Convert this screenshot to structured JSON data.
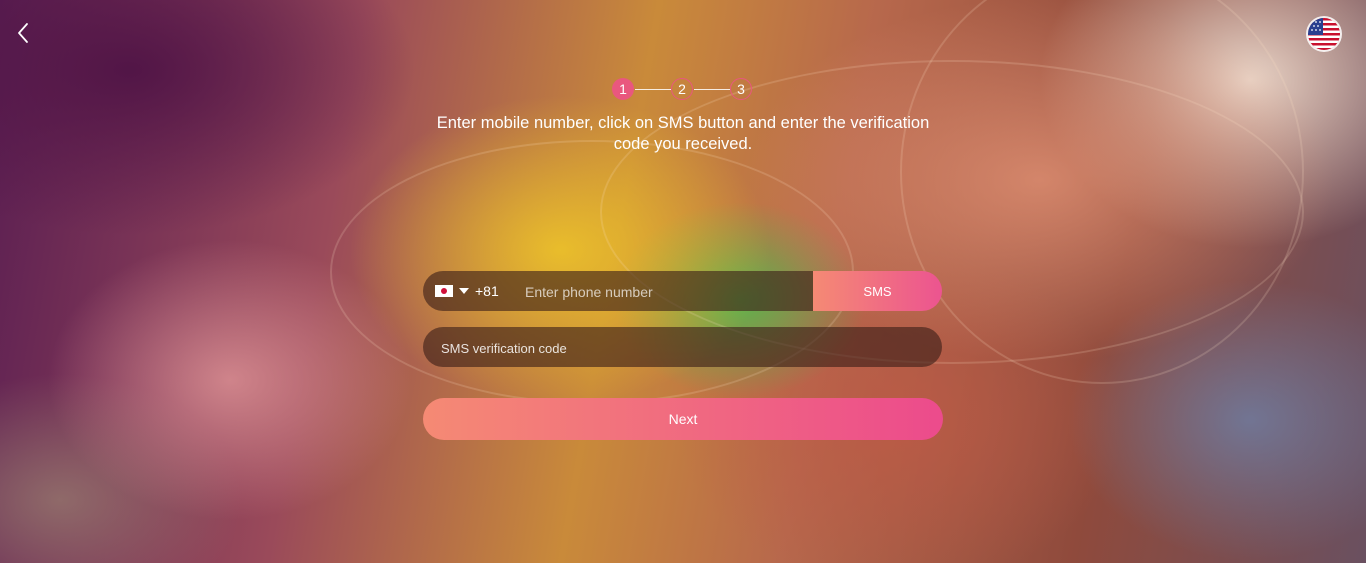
{
  "header": {
    "back_icon": "chevron-left-icon",
    "language_flag_icon": "us-flag-icon"
  },
  "steps": [
    {
      "label": "1",
      "state": "active"
    },
    {
      "label": "2",
      "state": "inactive"
    },
    {
      "label": "3",
      "state": "inactive"
    }
  ],
  "instruction": "Enter mobile number, click on SMS button and enter the verification code you received.",
  "phone": {
    "country_flag_icon": "jp-flag-icon",
    "dial_code": "+81",
    "value": "",
    "placeholder": "Enter phone number",
    "sms_label": "SMS"
  },
  "verification": {
    "value": "",
    "placeholder": "SMS verification code"
  },
  "next_label": "Next",
  "colors": {
    "accent": "#e9577e",
    "gradient_start": "#f58a74",
    "gradient_end": "#ec4b8c"
  }
}
